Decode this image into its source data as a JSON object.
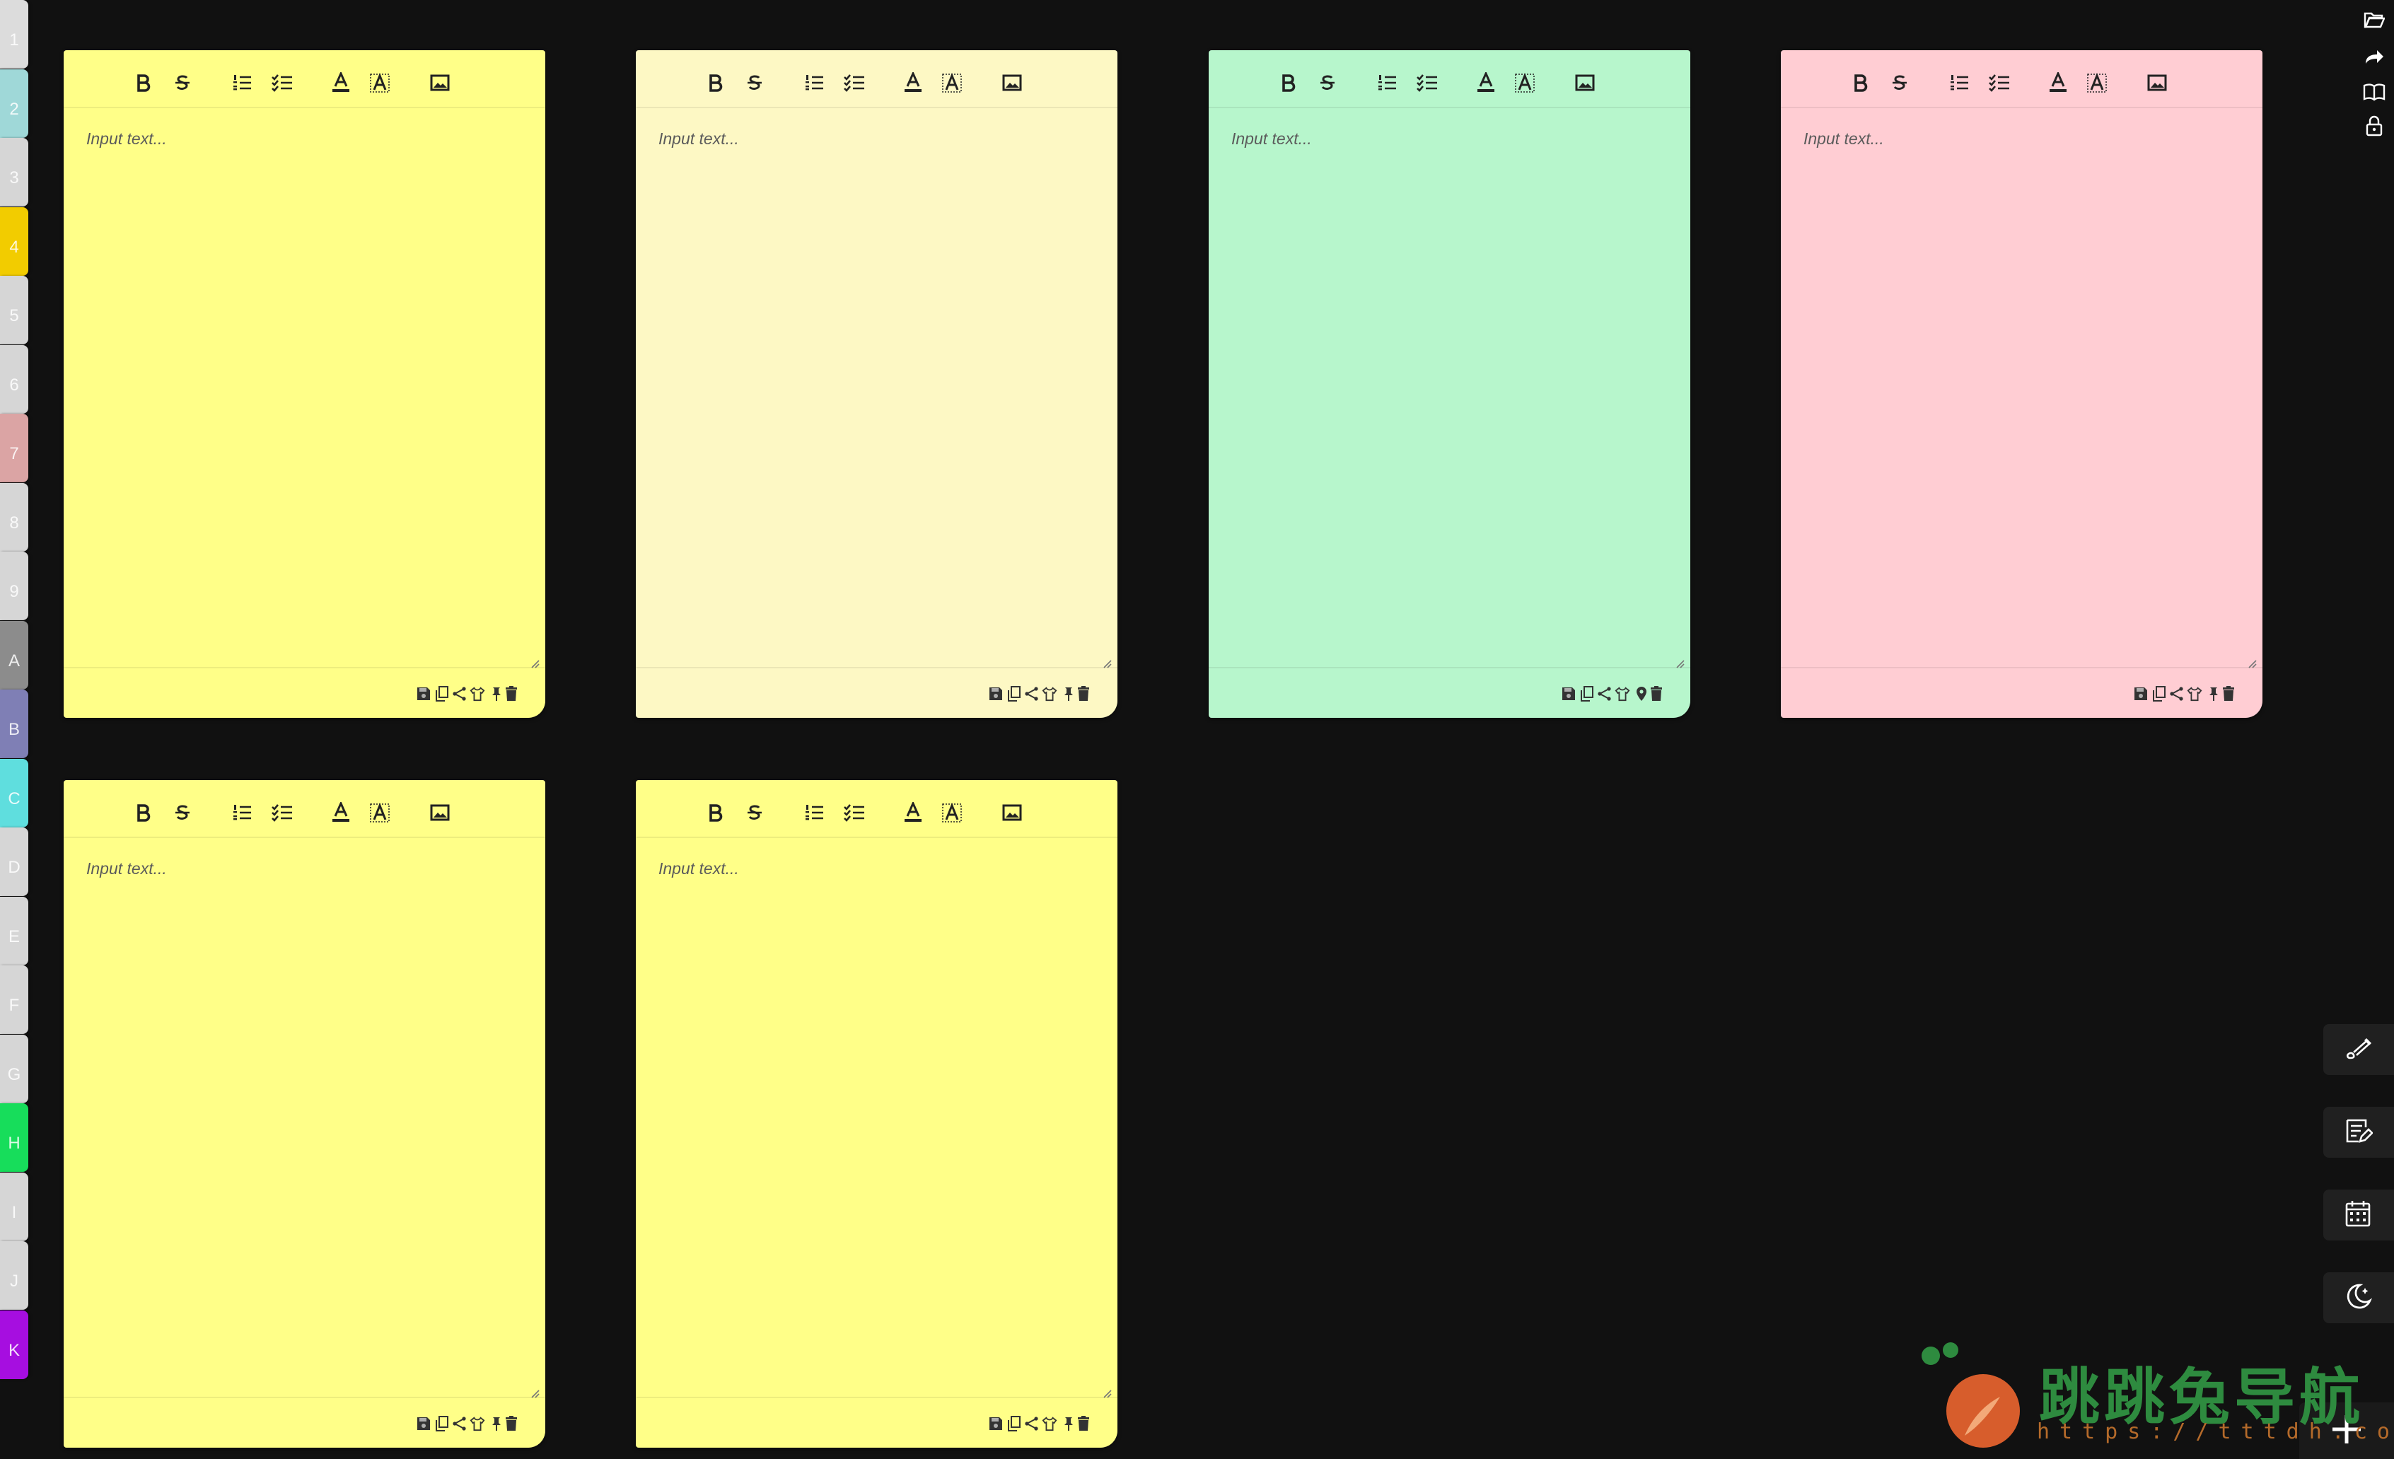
{
  "tabs": [
    {
      "label": "1",
      "color": "#dcdcdc"
    },
    {
      "label": "2",
      "color": "#9fd8d8"
    },
    {
      "label": "3",
      "color": "#d6d6d6"
    },
    {
      "label": "4",
      "color": "#f2cc00"
    },
    {
      "label": "5",
      "color": "#d6d6d6"
    },
    {
      "label": "6",
      "color": "#d6d6d6"
    },
    {
      "label": "7",
      "color": "#dba4a4"
    },
    {
      "label": "8",
      "color": "#d6d6d6"
    },
    {
      "label": "9",
      "color": "#d6d6d6"
    },
    {
      "label": "A",
      "color": "#8c8c8c"
    },
    {
      "label": "B",
      "color": "#7f7fb5"
    },
    {
      "label": "C",
      "color": "#5fdede"
    },
    {
      "label": "D",
      "color": "#d6d6d6"
    },
    {
      "label": "E",
      "color": "#d6d6d6"
    },
    {
      "label": "F",
      "color": "#d6d6d6"
    },
    {
      "label": "G",
      "color": "#d6d6d6"
    },
    {
      "label": "H",
      "color": "#17dd5b"
    },
    {
      "label": "I",
      "color": "#d6d6d6"
    },
    {
      "label": "J",
      "color": "#d6d6d6"
    },
    {
      "label": "K",
      "color": "#a60ee0"
    }
  ],
  "notes": [
    {
      "color": "#ffff88",
      "placeholder": "Input text...",
      "pin": "pin-icon"
    },
    {
      "color": "#fdf8c4",
      "placeholder": "Input text...",
      "pin": "pin-icon"
    },
    {
      "color": "#b7f6cc",
      "placeholder": "Input text...",
      "pin": "map-pin-icon"
    },
    {
      "color": "#ffcdd3",
      "placeholder": "Input text...",
      "pin": "pin-icon"
    },
    {
      "color": "#ffff88",
      "placeholder": "Input text...",
      "pin": "pin-icon"
    },
    {
      "color": "#ffff88",
      "placeholder": "Input text...",
      "pin": "pin-icon"
    }
  ],
  "toolbar_icons": [
    "bold-icon",
    "strikethrough-icon",
    "ordered-list-icon",
    "checklist-icon",
    "font-color-icon",
    "highlight-icon",
    "image-icon"
  ],
  "footer_icons": [
    "save-icon",
    "copy-icon",
    "share-icon",
    "palette-icon",
    "pin-icon",
    "trash-icon"
  ],
  "top_icons": [
    "folder-open-icon",
    "redo-icon",
    "book-icon",
    "lock-icon"
  ],
  "side_buttons": [
    "brush-icon",
    "edit-note-icon",
    "calendar-icon",
    "dark-mode-icon"
  ],
  "add_button": "plus-icon",
  "watermark": {
    "text": "跳跳兔导航",
    "url": "https://tttdh.com",
    "accent": "#2e8b3f"
  }
}
